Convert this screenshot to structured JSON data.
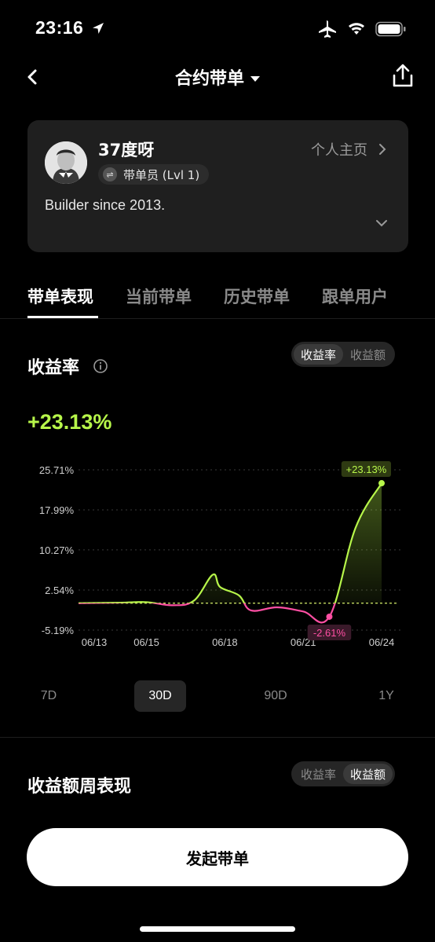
{
  "status_bar": {
    "time": "23:16"
  },
  "nav": {
    "title": "合约带单"
  },
  "profile": {
    "username": "37度呀",
    "badge": "带单员 (Lvl 1)",
    "home_link": "个人主页",
    "bio": "Builder since 2013."
  },
  "tabs": [
    {
      "label": "带单表现",
      "active": true
    },
    {
      "label": "当前带单",
      "active": false
    },
    {
      "label": "历史带单",
      "active": false
    },
    {
      "label": "跟单用户",
      "active": false
    }
  ],
  "profit_section": {
    "title": "收益率",
    "toggle": [
      "收益率",
      "收益额"
    ],
    "toggle_selected": "收益率",
    "value": "+23.13%"
  },
  "chart_data": {
    "type": "line",
    "y_ticks": [
      "25.71%",
      "17.99%",
      "10.27%",
      "2.54%",
      "-5.19%"
    ],
    "ylim": [
      -5.19,
      25.71
    ],
    "x_ticks": [
      "06/13",
      "06/15",
      "06/18",
      "06/21",
      "06/24"
    ],
    "baseline": 0,
    "series": [
      {
        "x": [
          "06/13",
          "06/14",
          "06/15",
          "06/16",
          "06/17",
          "06/17",
          "06/18",
          "06/18",
          "06/19",
          "06/20",
          "06/21",
          "06/22",
          "06/23",
          "06/24"
        ],
        "values": [
          0,
          0.1,
          0.2,
          -0.4,
          0.5,
          5.5,
          3.1,
          1.5,
          -1.4,
          -0.8,
          -1.6,
          -2.61,
          14.5,
          23.13
        ]
      }
    ],
    "annotations": [
      {
        "label": "+23.13%",
        "x": "06/24",
        "y": 23.13
      },
      {
        "label": "-2.61%",
        "x": "06/22",
        "y": -2.61
      }
    ],
    "colors": {
      "positive": "#b7f64a",
      "negative": "#ff4fa3",
      "grid": "#3a3a3a",
      "zero_line": "#d6ef6a"
    },
    "grid": true
  },
  "periods": [
    {
      "label": "7D",
      "active": false
    },
    {
      "label": "30D",
      "active": true
    },
    {
      "label": "90D",
      "active": false
    },
    {
      "label": "1Y",
      "active": false
    }
  ],
  "weekly_section": {
    "title": "收益额周表现",
    "toggle": [
      "收益率",
      "收益额"
    ],
    "toggle_selected": "收益额"
  },
  "cta": {
    "label": "发起带单"
  }
}
